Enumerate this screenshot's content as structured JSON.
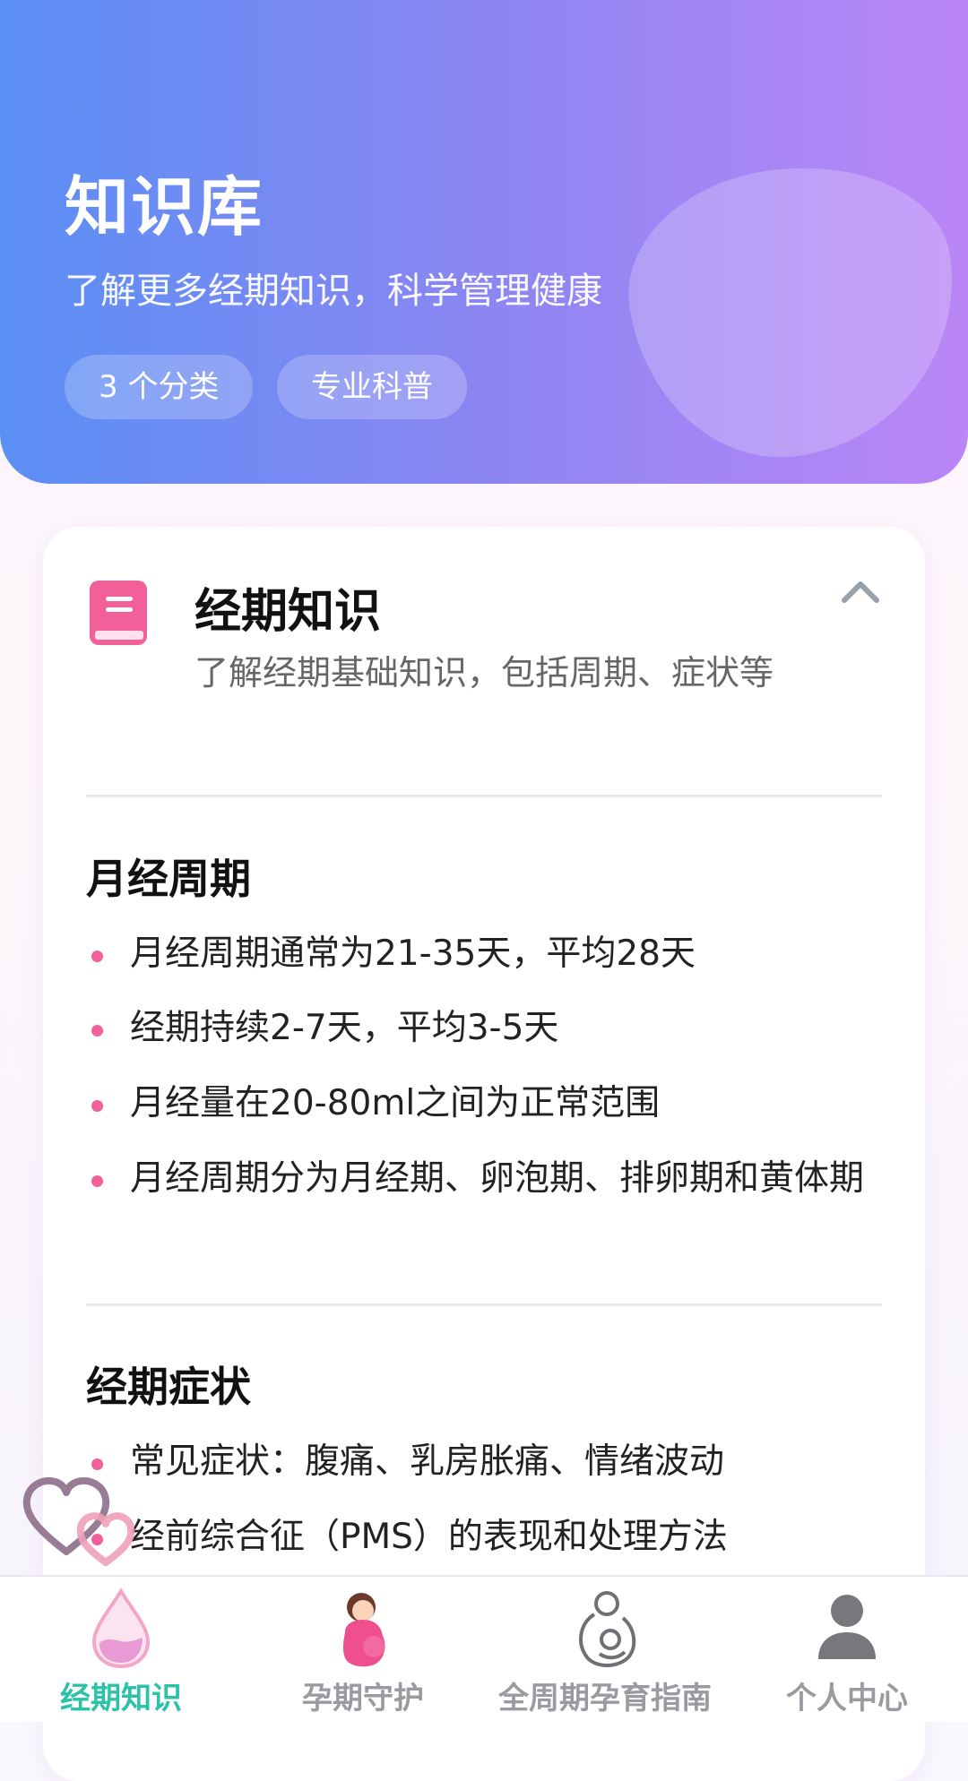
{
  "header": {
    "title": "知识库",
    "subtitle": "了解更多经期知识，科学管理健康",
    "chips": [
      "3 个分类",
      "专业科普"
    ]
  },
  "category": {
    "icon": "book-icon",
    "title": "经期知识",
    "description": "了解经期基础知识，包括周期、症状等",
    "expanded": true,
    "sections": [
      {
        "title": "月经周期",
        "items": [
          "月经周期通常为21-35天，平均28天",
          "经期持续2-7天，平均3-5天",
          "月经量在20-80ml之间为正常范围",
          "月经周期分为月经期、卵泡期、排卵期和黄体期"
        ]
      },
      {
        "title": "经期症状",
        "items": [
          "常见症状：腹痛、乳房胀痛、情绪波动",
          "经前综合征（PMS）的表现和处理方法"
        ]
      }
    ]
  },
  "tabs": [
    {
      "label": "经期知识",
      "icon": "droplet-icon",
      "active": true
    },
    {
      "label": "孕期守护",
      "icon": "pregnant-woman-icon",
      "active": false
    },
    {
      "label": "全周期孕育指南",
      "icon": "mother-baby-icon",
      "active": false
    },
    {
      "label": "个人中心",
      "icon": "person-icon",
      "active": false
    }
  ],
  "colors": {
    "header_gradient": [
      "#5a8ff4",
      "#bb86f6"
    ],
    "accent_pink": "#f2609a",
    "active_tab": "#2cc2a8"
  }
}
